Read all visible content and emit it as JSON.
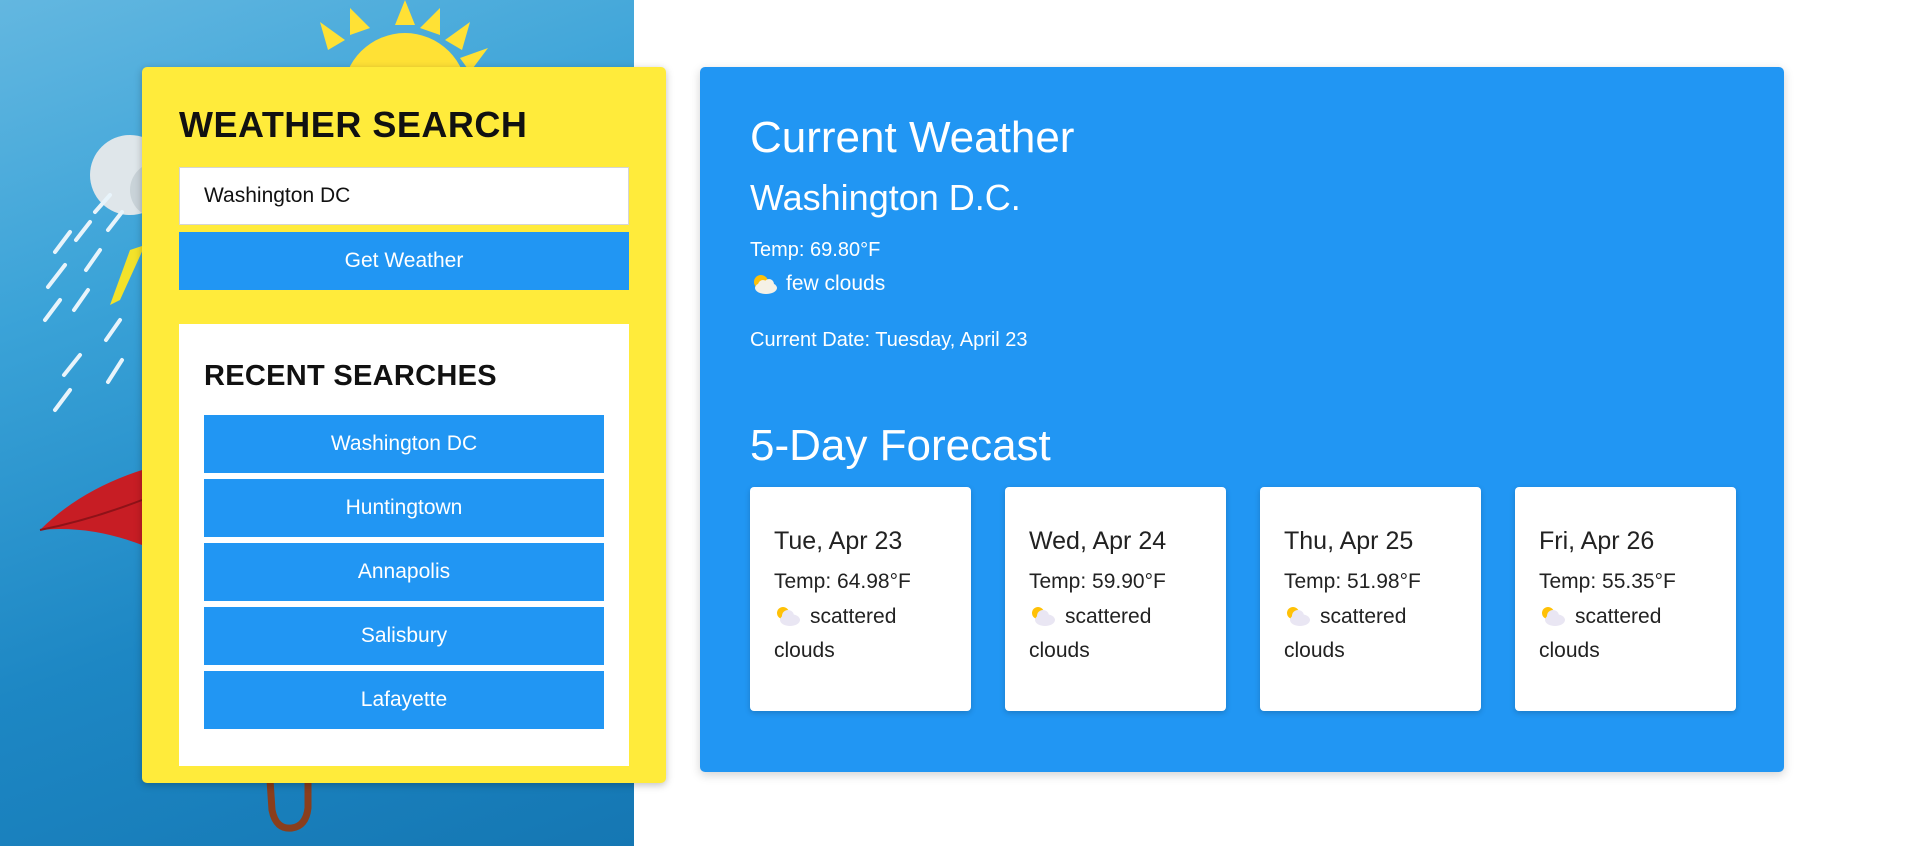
{
  "search": {
    "title": "WEATHER SEARCH",
    "input_value": "Washington DC",
    "button_label": "Get Weather"
  },
  "recent": {
    "title": "RECENT SEARCHES",
    "items": [
      "Washington DC",
      "Huntingtown",
      "Annapolis",
      "Salisbury",
      "Lafayette"
    ]
  },
  "current": {
    "title": "Current Weather",
    "city": "Washington D.C.",
    "temp": "Temp: 69.80°F",
    "condition": "few clouds",
    "condition_icon": "sun-behind-cloud-icon",
    "date": "Current Date: Tuesday, April 23"
  },
  "forecast": {
    "title": "5-Day Forecast",
    "days": [
      {
        "date": "Tue, Apr 23",
        "temp": "Temp: 64.98°F",
        "condition": "scattered clouds",
        "icon": "cloud-icon"
      },
      {
        "date": "Wed, Apr 24",
        "temp": "Temp: 59.90°F",
        "condition": "scattered clouds",
        "icon": "cloud-icon"
      },
      {
        "date": "Thu, Apr 25",
        "temp": "Temp: 51.98°F",
        "condition": "scattered clouds",
        "icon": "cloud-icon"
      },
      {
        "date": "Fri, Apr 26",
        "temp": "Temp: 55.35°F",
        "condition": "scattered clouds",
        "icon": "cloud-icon"
      }
    ]
  },
  "colors": {
    "accent_blue": "#2196f3",
    "search_yellow": "#ffeb3b"
  }
}
